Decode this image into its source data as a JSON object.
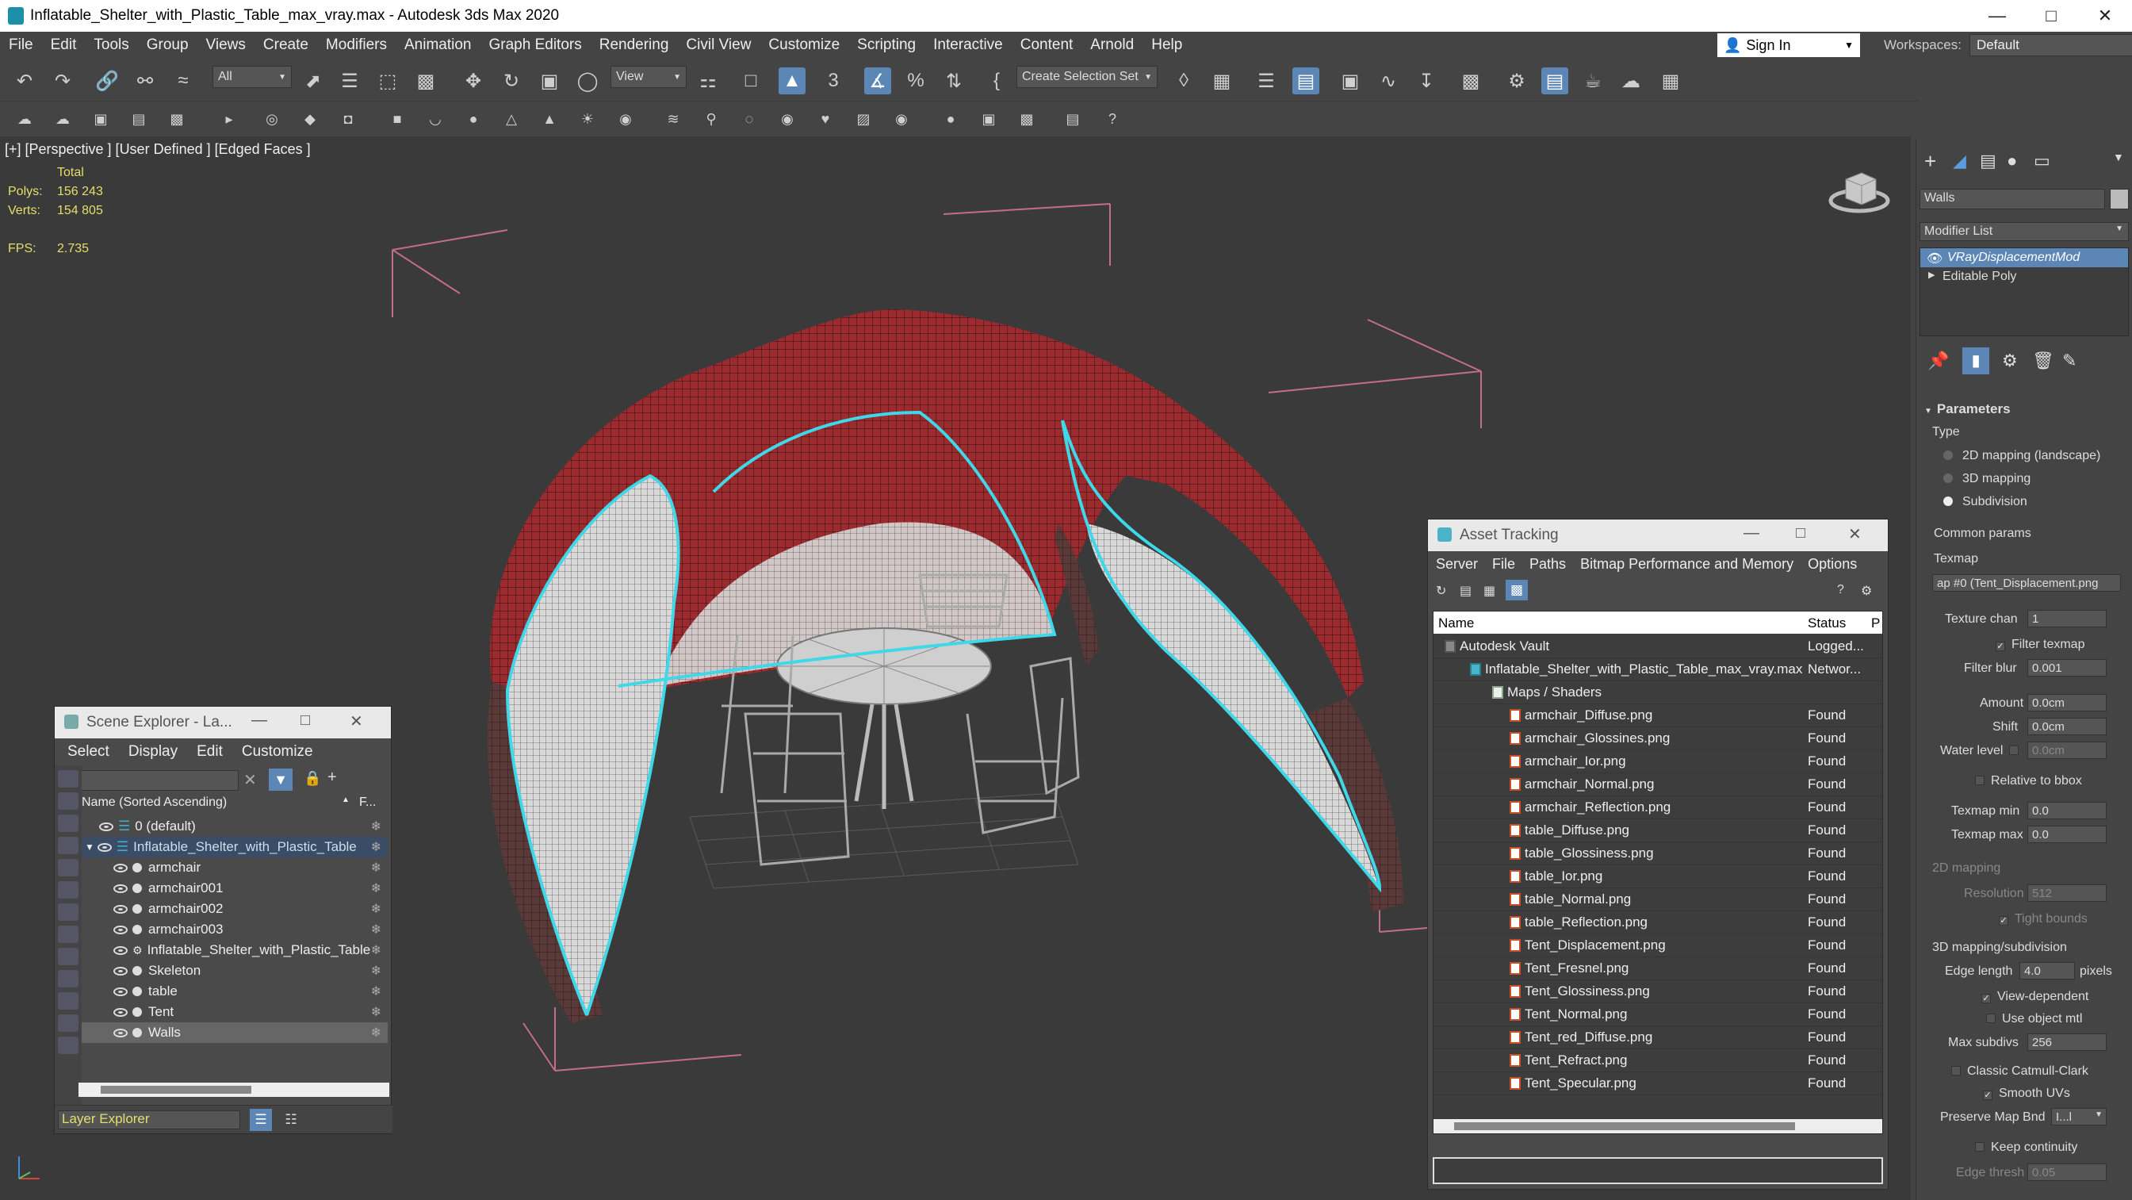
{
  "window": {
    "title": "Inflatable_Shelter_with_Plastic_Table_max_vray.max - Autodesk 3ds Max 2020"
  },
  "menu": [
    "File",
    "Edit",
    "Tools",
    "Group",
    "Views",
    "Create",
    "Modifiers",
    "Animation",
    "Graph Editors",
    "Rendering",
    "Civil View",
    "Customize",
    "Scripting",
    "Interactive",
    "Content",
    "Arnold",
    "Help"
  ],
  "account": {
    "sign_in": "Sign In",
    "workspaces_label": "Workspaces:",
    "workspace": "Default"
  },
  "toolbar": {
    "filter": "All",
    "ref_coord": "View",
    "selection_set": "Create Selection Set"
  },
  "viewport": {
    "label": "[+] [Perspective ] [User Defined ] [Edged Faces ]",
    "stats": {
      "total_label": "Total",
      "polys_label": "Polys:",
      "polys": "156 243",
      "verts_label": "Verts:",
      "verts": "154 805",
      "fps_label": "FPS:",
      "fps": "2.735"
    }
  },
  "scene_explorer": {
    "title": "Scene Explorer - La...",
    "menu": [
      "Select",
      "Display",
      "Edit",
      "Customize"
    ],
    "column_name": "Name (Sorted Ascending)",
    "column_f": "F...",
    "rows": [
      {
        "name": "0 (default)",
        "indent": 0
      },
      {
        "name": "Inflatable_Shelter_with_Plastic_Table",
        "indent": 0
      },
      {
        "name": "armchair",
        "indent": 1
      },
      {
        "name": "armchair001",
        "indent": 1
      },
      {
        "name": "armchair002",
        "indent": 1
      },
      {
        "name": "armchair003",
        "indent": 1
      },
      {
        "name": "Inflatable_Shelter_with_Plastic_Table",
        "indent": 1
      },
      {
        "name": "Skeleton",
        "indent": 1
      },
      {
        "name": "table",
        "indent": 1
      },
      {
        "name": "Tent",
        "indent": 1
      },
      {
        "name": "Walls",
        "indent": 1
      }
    ],
    "footer": "Layer Explorer"
  },
  "asset_tracking": {
    "title": "Asset Tracking",
    "menu": [
      "Server",
      "File",
      "Paths",
      "Bitmap Performance and Memory",
      "Options"
    ],
    "col_name": "Name",
    "col_status": "Status",
    "col_p": "P",
    "rows": [
      {
        "name": "Autodesk Vault",
        "status": "Logged...",
        "level": 0
      },
      {
        "name": "Inflatable_Shelter_with_Plastic_Table_max_vray.max",
        "status": "Networ...",
        "level": 1
      },
      {
        "name": "Maps / Shaders",
        "status": "",
        "level": 2
      },
      {
        "name": "armchair_Diffuse.png",
        "status": "Found",
        "level": 3
      },
      {
        "name": "armchair_Glossines.png",
        "status": "Found",
        "level": 3
      },
      {
        "name": "armchair_Ior.png",
        "status": "Found",
        "level": 3
      },
      {
        "name": "armchair_Normal.png",
        "status": "Found",
        "level": 3
      },
      {
        "name": "armchair_Reflection.png",
        "status": "Found",
        "level": 3
      },
      {
        "name": "table_Diffuse.png",
        "status": "Found",
        "level": 3
      },
      {
        "name": "table_Glossiness.png",
        "status": "Found",
        "level": 3
      },
      {
        "name": "table_Ior.png",
        "status": "Found",
        "level": 3
      },
      {
        "name": "table_Normal.png",
        "status": "Found",
        "level": 3
      },
      {
        "name": "table_Reflection.png",
        "status": "Found",
        "level": 3
      },
      {
        "name": "Tent_Displacement.png",
        "status": "Found",
        "level": 3
      },
      {
        "name": "Tent_Fresnel.png",
        "status": "Found",
        "level": 3
      },
      {
        "name": "Tent_Glossiness.png",
        "status": "Found",
        "level": 3
      },
      {
        "name": "Tent_Normal.png",
        "status": "Found",
        "level": 3
      },
      {
        "name": "Tent_red_Diffuse.png",
        "status": "Found",
        "level": 3
      },
      {
        "name": "Tent_Refract.png",
        "status": "Found",
        "level": 3
      },
      {
        "name": "Tent_Specular.png",
        "status": "Found",
        "level": 3
      }
    ]
  },
  "command_panel": {
    "object_name": "Walls",
    "modifier_list": "Modifier List",
    "stack": [
      "VRayDisplacementMod",
      "Editable Poly"
    ],
    "parameters": "Parameters",
    "type_label": "Type",
    "type_options": [
      "2D mapping (landscape)",
      "3D mapping",
      "Subdivision"
    ],
    "common_params": "Common params",
    "texmap_label": "Texmap",
    "texmap_value": "ap #0 (Tent_Displacement.png",
    "texture_chan_label": "Texture chan",
    "texture_chan": "1",
    "filter_texmap": "Filter texmap",
    "filter_blur_label": "Filter blur",
    "filter_blur": "0.001",
    "amount_label": "Amount",
    "amount": "0.0cm",
    "shift_label": "Shift",
    "shift": "0.0cm",
    "water_level_label": "Water level",
    "water_level": "0.0cm",
    "relative_to_bbox": "Relative to bbox",
    "texmap_min_label": "Texmap min",
    "texmap_min": "0.0",
    "texmap_max_label": "Texmap max",
    "texmap_max": "0.0",
    "mapping_2d": "2D mapping",
    "resolution_label": "Resolution",
    "resolution": "512",
    "tight_bounds": "Tight bounds",
    "mapping_3d": "3D mapping/subdivision",
    "edge_length_label": "Edge length",
    "edge_length": "4.0",
    "pixels": "pixels",
    "view_dependent": "View-dependent",
    "use_object_mtl": "Use object mtl",
    "max_subdivs_label": "Max subdivs",
    "max_subdivs": "256",
    "classic_catmull": "Classic Catmull-Clark",
    "smooth_uvs": "Smooth UVs",
    "preserve_map_label": "Preserve Map Bnd",
    "preserve_map": "I...l",
    "keep_continuity": "Keep continuity",
    "edge_thresh_label": "Edge thresh",
    "edge_thresh": "0.05"
  },
  "colors": {
    "tent": "#9c2b30",
    "selection": "#3fd8e8",
    "accent": "#5b86b5"
  }
}
